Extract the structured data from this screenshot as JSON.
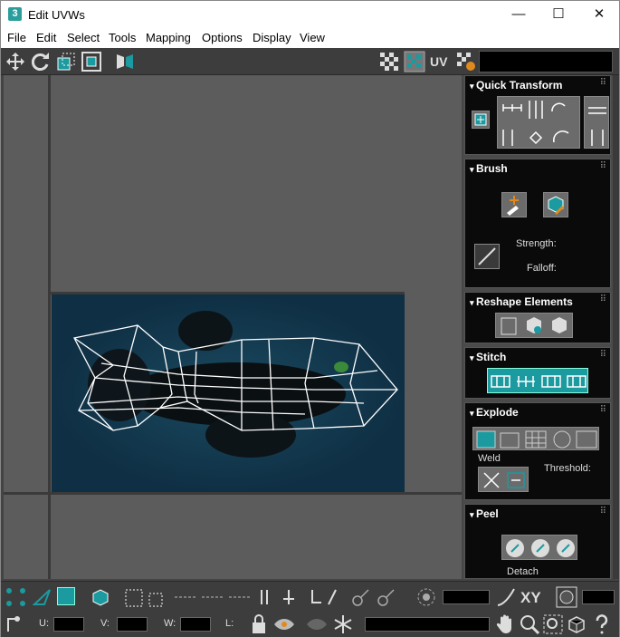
{
  "window": {
    "title": "Edit UVWs",
    "app_icon": "3",
    "min": "—",
    "max": "☐",
    "close": "✕"
  },
  "menu": [
    "File",
    "Edit",
    "Select",
    "Tools",
    "Mapping",
    "Options",
    "Display",
    "View"
  ],
  "toolbar": {
    "uv_label": "UV",
    "texture_dropdown": ""
  },
  "rollouts": {
    "quick_transform": {
      "title": "Quick Transform"
    },
    "brush": {
      "title": "Brush",
      "strength": "Strength:",
      "falloff": "Falloff:"
    },
    "reshape": {
      "title": "Reshape Elements"
    },
    "stitch": {
      "title": "Stitch"
    },
    "explode": {
      "title": "Explode",
      "weld": "Weld",
      "threshold": "Threshold:"
    },
    "peel": {
      "title": "Peel",
      "detach": "Detach"
    }
  },
  "bottom": {
    "xy_label": "XY",
    "u_label": "U:",
    "v_label": "V:",
    "w_label": "W:",
    "l_label": "L:",
    "u_value": "",
    "v_value": "",
    "w_value": "",
    "l_value": ""
  },
  "colors": {
    "accent": "#1b9aa0",
    "background": "#444444",
    "texture": "#0f2f44"
  }
}
